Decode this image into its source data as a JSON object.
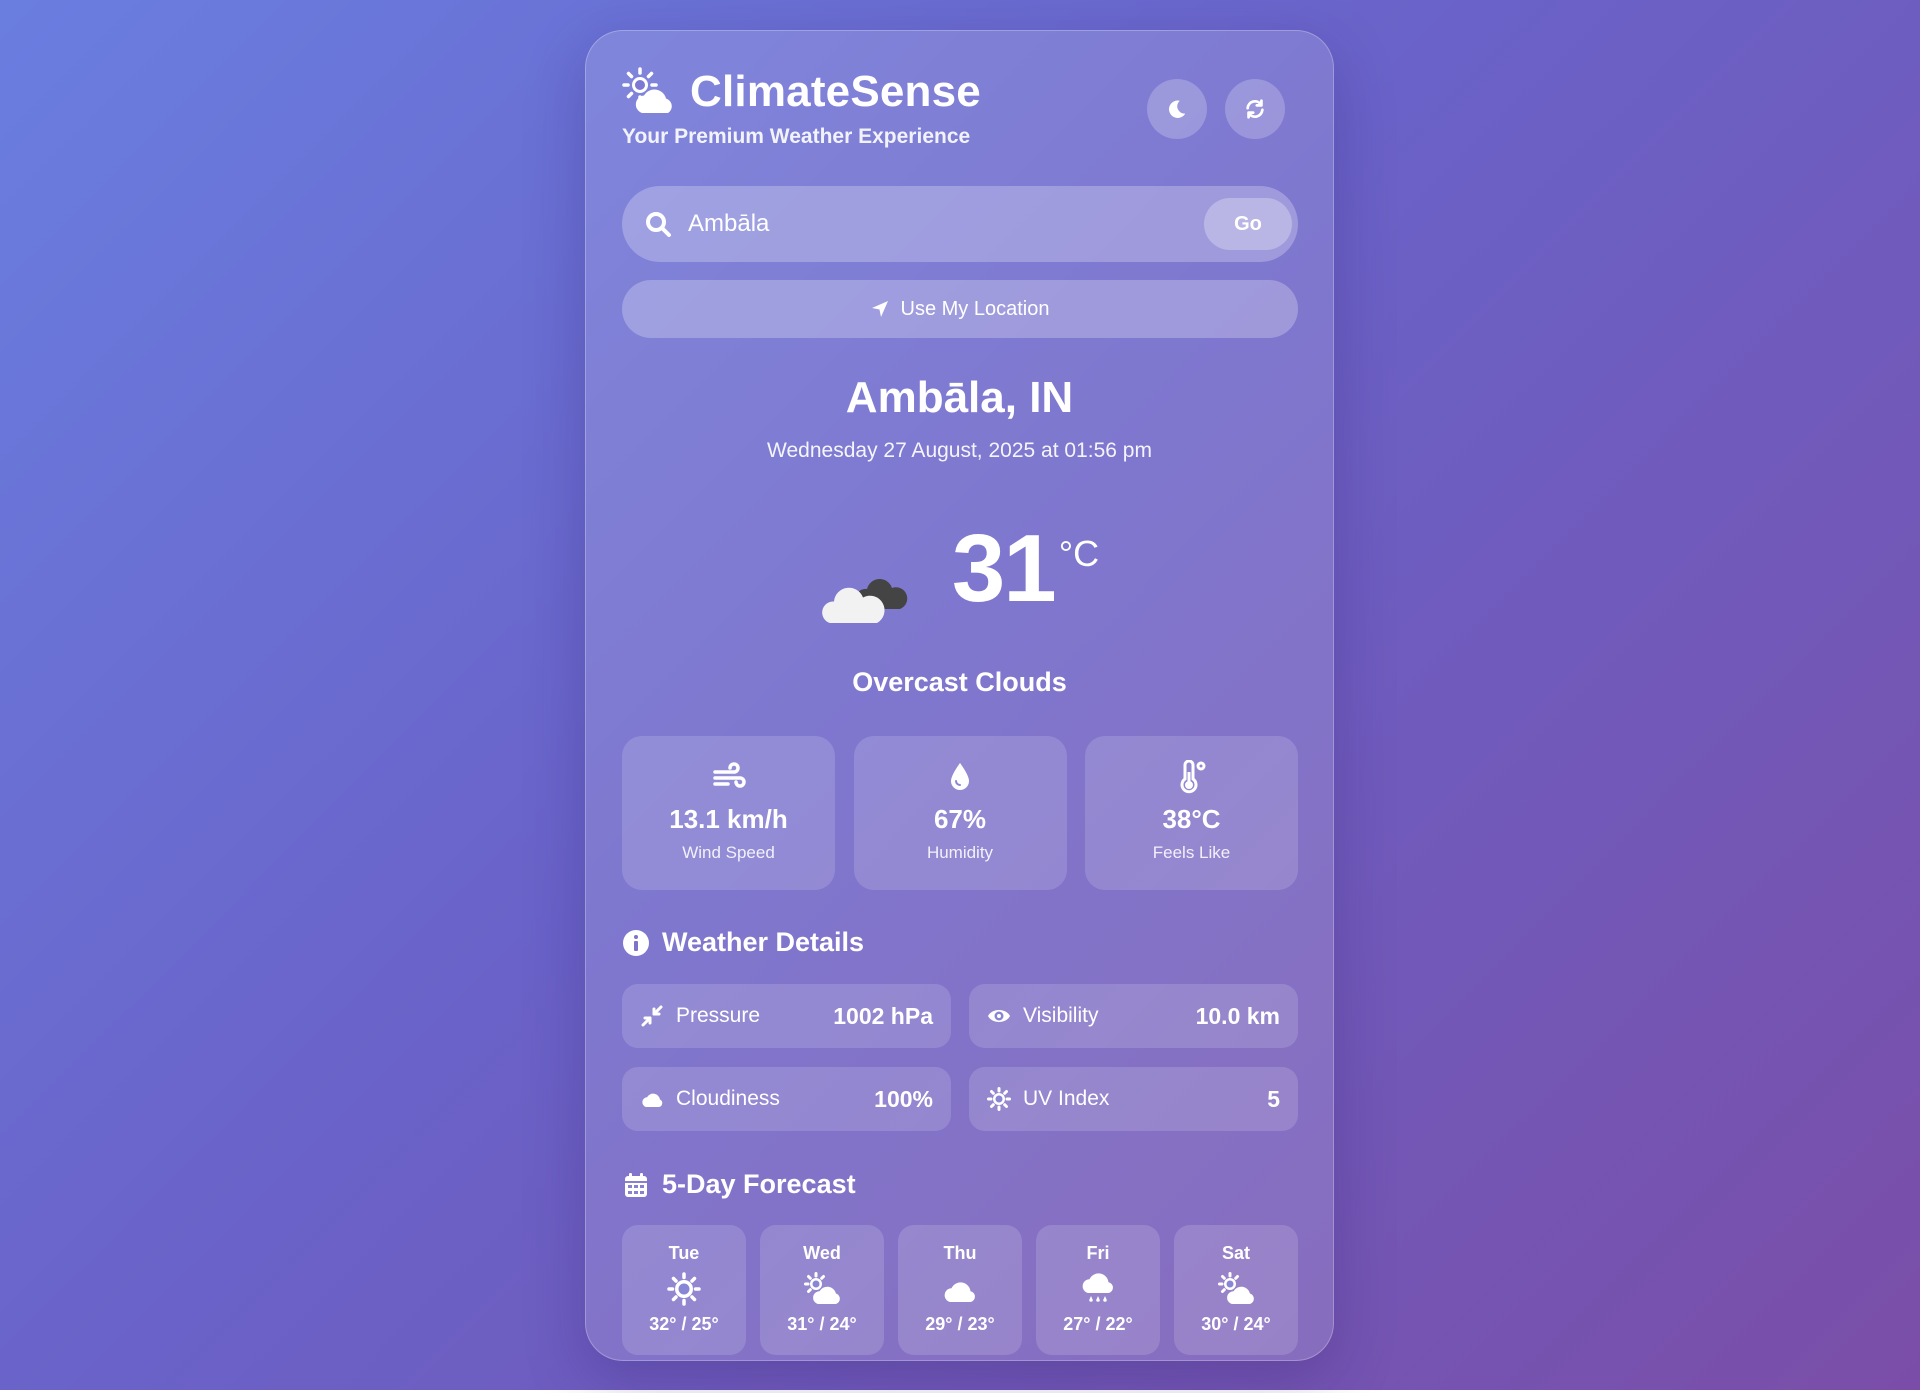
{
  "app": {
    "title": "ClimateSense",
    "tagline": "Your Premium Weather Experience",
    "theme_toggle_icon": "moon-icon",
    "refresh_icon": "refresh-icon"
  },
  "search": {
    "value": "Ambāla",
    "go_label": "Go",
    "location_button_label": "Use My Location"
  },
  "current": {
    "location": "Ambāla, IN",
    "datetime": "Wednesday 27 August, 2025 at 01:56 pm",
    "temperature": "31",
    "unit": "°C",
    "condition": "Overcast Clouds",
    "condition_icon": "overcast-clouds-icon"
  },
  "stats": [
    {
      "icon": "wind-icon",
      "value": "13.1 km/h",
      "label": "Wind Speed"
    },
    {
      "icon": "droplet-icon",
      "value": "67%",
      "label": "Humidity"
    },
    {
      "icon": "thermometer-icon",
      "value": "38°C",
      "label": "Feels Like"
    }
  ],
  "details": {
    "title": "Weather Details",
    "items": [
      {
        "icon": "compress-icon",
        "label": "Pressure",
        "value": "1002 hPa"
      },
      {
        "icon": "eye-icon",
        "label": "Visibility",
        "value": "10.0 km"
      },
      {
        "icon": "cloud-icon",
        "label": "Cloudiness",
        "value": "100%"
      },
      {
        "icon": "sun-icon",
        "label": "UV Index",
        "value": "5"
      }
    ]
  },
  "forecast": {
    "title": "5-Day Forecast",
    "days": [
      {
        "day": "Tue",
        "icon": "sun-icon",
        "temps": "32° / 25°"
      },
      {
        "day": "Wed",
        "icon": "sun-cloud-icon",
        "temps": "31° / 24°"
      },
      {
        "day": "Thu",
        "icon": "cloud-icon",
        "temps": "29° / 23°"
      },
      {
        "day": "Fri",
        "icon": "rain-icon",
        "temps": "27° / 22°"
      },
      {
        "day": "Sat",
        "icon": "sun-cloud-icon",
        "temps": "30° / 24°"
      }
    ]
  },
  "colors": {
    "background_start": "#6a7ee0",
    "background_end": "#7a4ea8",
    "text": "#ffffff"
  }
}
